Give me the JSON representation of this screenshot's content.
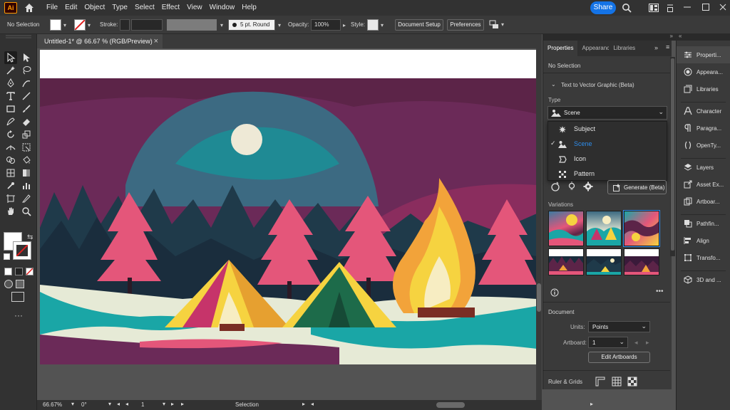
{
  "app": {
    "logo_text": "Ai",
    "accent": "#ff9a00"
  },
  "menu": [
    "File",
    "Edit",
    "Object",
    "Type",
    "Select",
    "Effect",
    "View",
    "Window",
    "Help"
  ],
  "share_label": "Share",
  "control_bar": {
    "selection_label": "No Selection",
    "stroke_label": "Stroke:",
    "brush_value": "5 pt. Round",
    "opacity_label": "Opacity:",
    "opacity_value": "100%",
    "style_label": "Style:",
    "document_setup": "Document Setup",
    "preferences": "Preferences"
  },
  "document": {
    "tab_title": "Untitled-1* @ 66.67 % (RGB/Preview)",
    "close_glyph": "×"
  },
  "status_bar": {
    "zoom": "66.67%",
    "rotation": "0°",
    "artboard_num": "1",
    "mode": "Selection"
  },
  "panel": {
    "tabs": [
      "Properties",
      "Appearance",
      "Libraries"
    ],
    "no_selection": "No Selection",
    "section_title": "Text to Vector Graphic (Beta)",
    "type_label": "Type",
    "type_value": "Scene",
    "type_options": [
      "Subject",
      "Scene",
      "Icon",
      "Pattern"
    ],
    "selected_option": "Scene",
    "generate_label": "Generate (Beta)",
    "variations_label": "Variations",
    "document_label": "Document",
    "units_label": "Units:",
    "units_value": "Points",
    "artboard_label": "Artboard:",
    "artboard_value": "1",
    "edit_artboards": "Edit Artboards",
    "rulers_label": "Ruler & Grids"
  },
  "dock": [
    "Properti...",
    "Appeara...",
    "Libraries",
    "Character",
    "Paragra...",
    "OpenTy...",
    "Layers",
    "Asset Ex...",
    "Artboar...",
    "Pathfin...",
    "Align",
    "Transfo...",
    "3D and ..."
  ],
  "colors": {
    "highlight": "#2d8ceb",
    "share": "#1473e6"
  }
}
